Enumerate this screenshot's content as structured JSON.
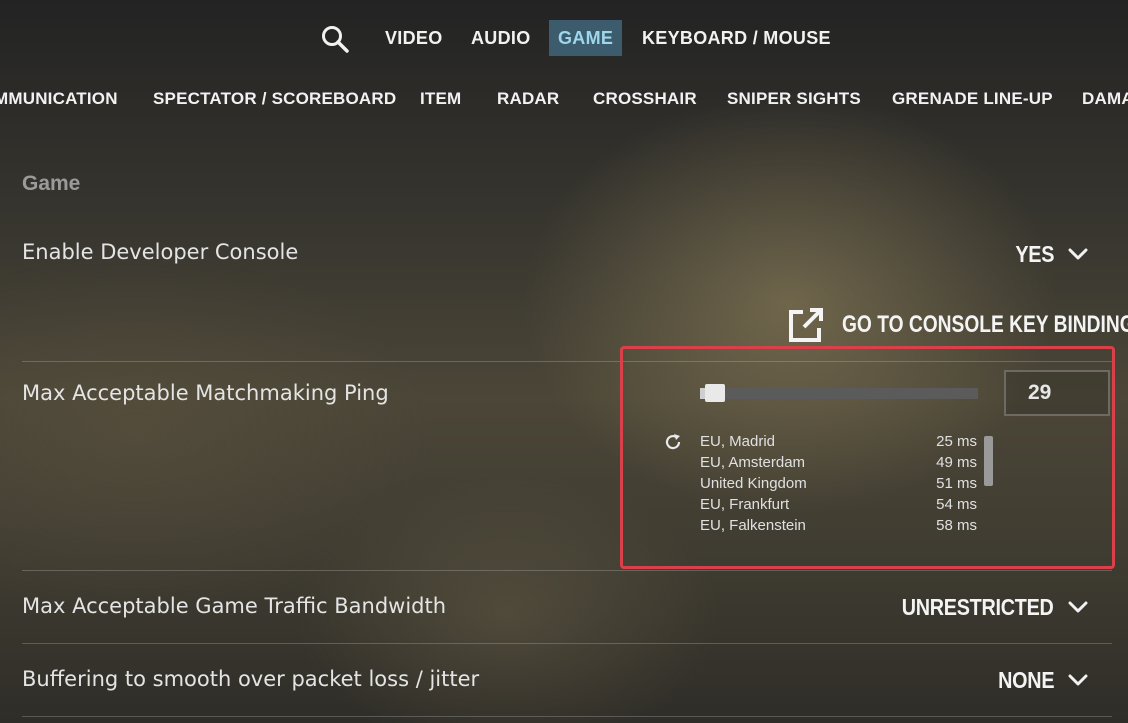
{
  "top_nav": {
    "search_icon": "search-icon",
    "tabs": [
      {
        "label": "VIDEO",
        "active": false
      },
      {
        "label": "AUDIO",
        "active": false
      },
      {
        "label": "GAME",
        "active": true
      },
      {
        "label": "KEYBOARD / MOUSE",
        "active": false
      }
    ]
  },
  "sub_nav": {
    "tabs": [
      "MMUNICATION",
      "SPECTATOR / SCOREBOARD",
      "ITEM",
      "RADAR",
      "CROSSHAIR",
      "SNIPER SIGHTS",
      "GRENADE LINE-UP",
      "DAMA"
    ]
  },
  "section": {
    "title": "Game"
  },
  "settings": {
    "developer_console": {
      "label": "Enable Developer Console",
      "value": "YES"
    },
    "console_key_binding": {
      "label": "GO TO CONSOLE KEY BINDING",
      "icon": "external-link-icon"
    },
    "matchmaking_ping": {
      "label": "Max Acceptable Matchmaking Ping",
      "value": "29",
      "slider_fraction": 0.03,
      "refresh_icon": "refresh-icon",
      "servers": [
        {
          "name": "EU, Madrid",
          "ping": "25 ms"
        },
        {
          "name": "EU, Amsterdam",
          "ping": "49 ms"
        },
        {
          "name": "United Kingdom",
          "ping": "51 ms"
        },
        {
          "name": "EU, Frankfurt",
          "ping": "54 ms"
        },
        {
          "name": "EU, Falkenstein",
          "ping": "58 ms"
        }
      ]
    },
    "traffic_bandwidth": {
      "label": "Max Acceptable Game Traffic Bandwidth",
      "value": "UNRESTRICTED"
    },
    "buffering": {
      "label": "Buffering to smooth over packet loss / jitter",
      "value": "NONE"
    }
  },
  "colors": {
    "active_tab_bg": "#3c5c6e",
    "active_tab_text": "#9fd6ea",
    "highlight_border": "#d9404a"
  }
}
